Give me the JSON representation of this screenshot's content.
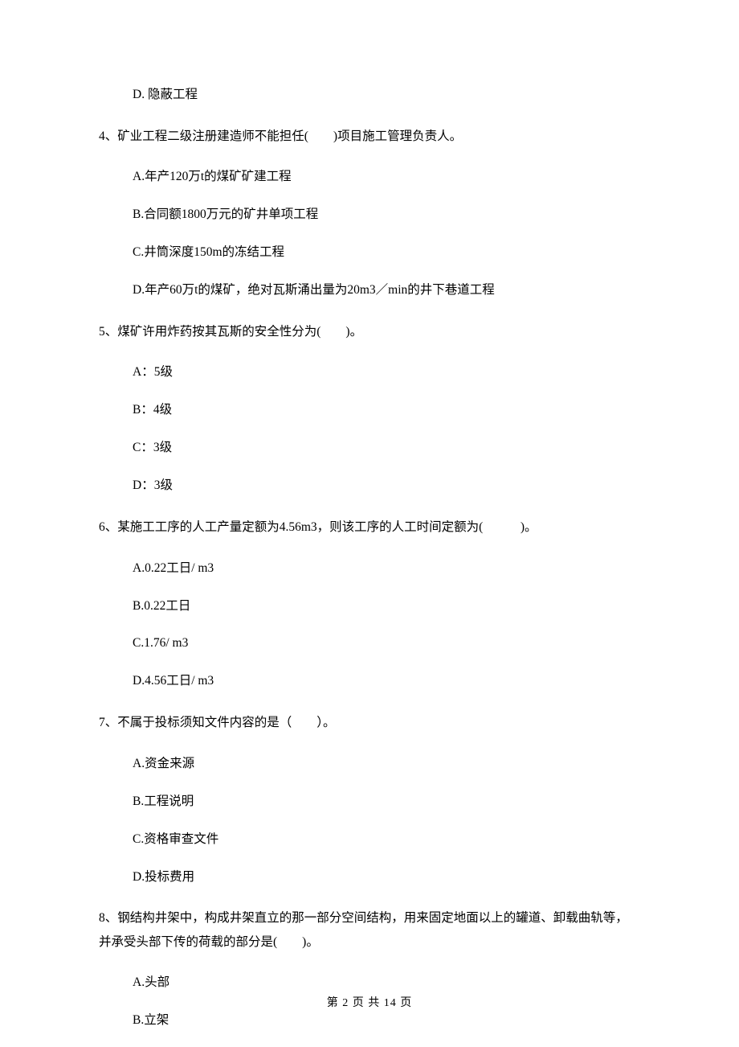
{
  "q3": {
    "optD": "D. 隐蔽工程"
  },
  "q4": {
    "stem": "4、矿业工程二级注册建造师不能担任(　　)项目施工管理负责人。",
    "optA": "A.年产120万t的煤矿矿建工程",
    "optB": "B.合同额1800万元的矿井单项工程",
    "optC": "C.井筒深度150m的冻结工程",
    "optD": "D.年产60万t的煤矿，绝对瓦斯涌出量为20m3／min的井下巷道工程"
  },
  "q5": {
    "stem": "5、煤矿许用炸药按其瓦斯的安全性分为(　　)。",
    "optA": "A：5级",
    "optB": "B：4级",
    "optC": "C：3级",
    "optD": "D：3级"
  },
  "q6": {
    "stem": "6、某施工工序的人工产量定额为4.56m3，则该工序的人工时间定额为(　　　)。",
    "optA": "A.0.22工日/ m3",
    "optB": "B.0.22工日",
    "optC": "C.1.76/ m3",
    "optD": "D.4.56工日/ m3"
  },
  "q7": {
    "stem": "7、不属于投标须知文件内容的是（　　）。",
    "optA": "A.资金来源",
    "optB": "B.工程说明",
    "optC": "C.资格审查文件",
    "optD": "D.投标费用"
  },
  "q8": {
    "stem": "8、钢结构井架中，构成井架直立的那一部分空间结构，用来固定地面以上的罐道、卸载曲轨等，并承受头部下传的荷载的部分是(　　)。",
    "optA": "A.头部",
    "optB": "B.立架"
  },
  "footer": "第 2 页 共 14 页"
}
